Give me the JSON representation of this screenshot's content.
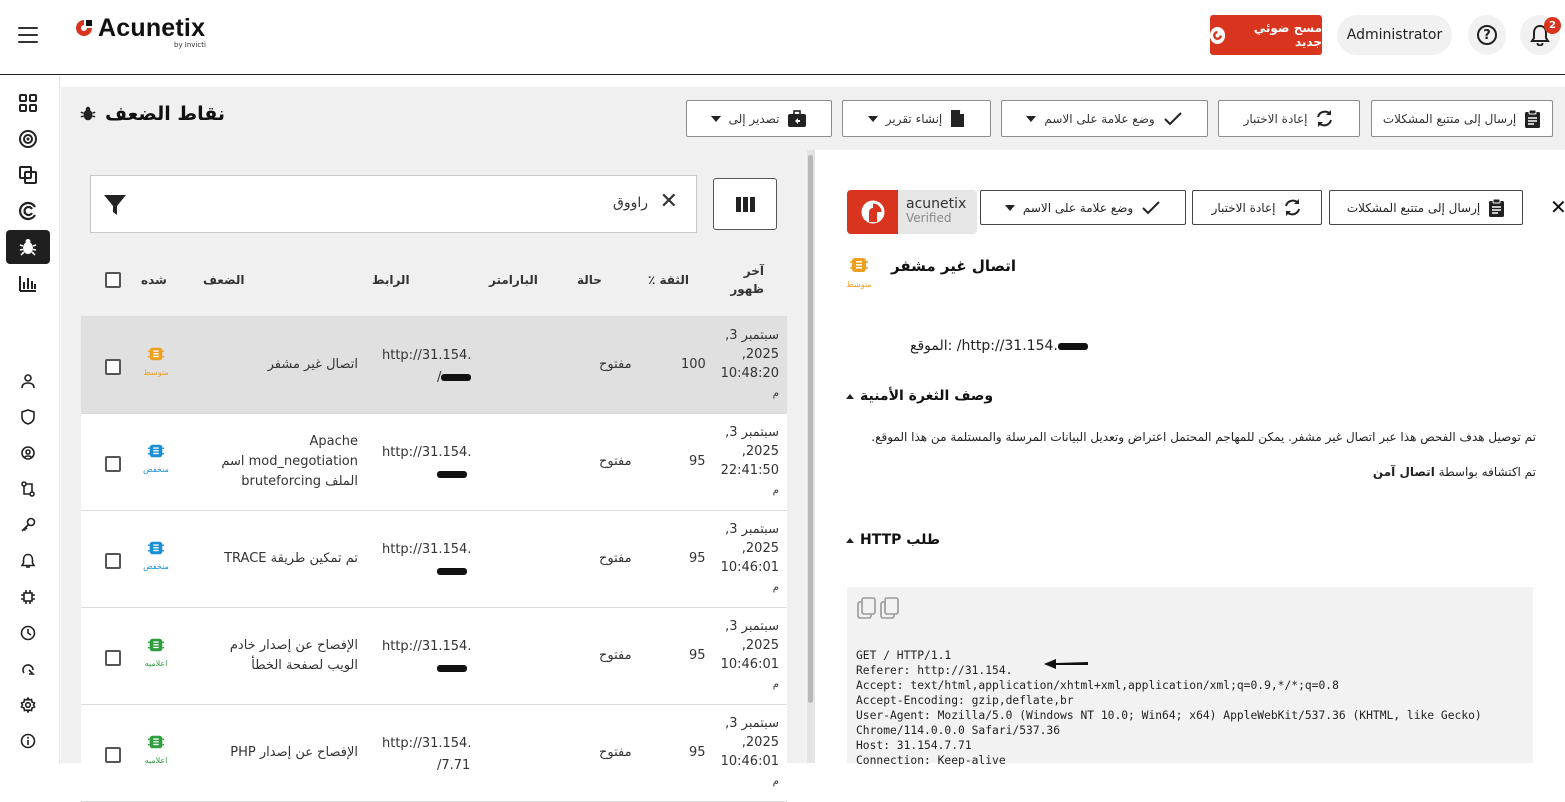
{
  "brand": {
    "name": "Acunetix",
    "sub": "by Invicti"
  },
  "topbar": {
    "new_scan_label": "مسح ضوئي جديد",
    "user_label": "Administrator",
    "help_glyph": "?",
    "notification_count": "2"
  },
  "sidebar": {
    "items": [
      {
        "icon": "dashboard-icon"
      },
      {
        "icon": "targets-icon"
      },
      {
        "icon": "scans-icon"
      },
      {
        "icon": "scan-profiles-icon"
      },
      {
        "icon": "vulnerabilities-bug-icon",
        "active": true
      },
      {
        "icon": "reports-icon"
      },
      {
        "icon": "users-icon"
      },
      {
        "icon": "shield-icon"
      },
      {
        "icon": "roles-icon"
      },
      {
        "icon": "integrations-icon"
      },
      {
        "icon": "key-icon"
      },
      {
        "icon": "notifications-icon"
      },
      {
        "icon": "agents-icon"
      },
      {
        "icon": "history-icon"
      },
      {
        "icon": "export-icon"
      },
      {
        "icon": "settings-icon"
      },
      {
        "icon": "info-icon"
      }
    ]
  },
  "page": {
    "title": "نقاط الضعف",
    "export_label": "تصدير إلى",
    "report_label": "إنشاء تقرير",
    "mark_label": "وضع علامة على الاسم",
    "retest_label": "إعادة الاختبار",
    "tracker_label": "إرسال إلى متتبع المشكلات"
  },
  "list": {
    "search_value": "راووق",
    "columns": {
      "severity": "شده",
      "vulnerability": "الضعف",
      "url": "الرابط",
      "parameter": "البارامتر",
      "status": "حالة",
      "confidence": "الثقة ٪",
      "last_seen": "آخر ظهور"
    },
    "rows": [
      {
        "severity": "متوسط",
        "vuln": "اتصال غير مشفر",
        "url": "http://31.154.",
        "url2": "/",
        "status": "مفتوح",
        "conf": "100",
        "date": "سبتمبر 3,",
        "year": "2025,",
        "time": "10:48:20",
        "ampm": "م"
      },
      {
        "severity": "منخفض",
        "vuln": "Apache mod_negotiation اسم الملف bruteforcing",
        "url": "http://31.154.",
        "url2": "",
        "status": "مفتوح",
        "conf": "95",
        "date": "سبتمبر 3,",
        "year": "2025,",
        "time": "22:41:50",
        "ampm": "م"
      },
      {
        "severity": "منخفض",
        "vuln": "تم تمكين طريقة TRACE",
        "url": "http://31.154.",
        "url2": "",
        "status": "مفتوح",
        "conf": "95",
        "date": "سبتمبر 3,",
        "year": "2025,",
        "time": "10:46:01",
        "ampm": "م"
      },
      {
        "severity": "اعلاميه",
        "vuln": "الإفصاح عن إصدار خادم الويب لصفحة الخطأ",
        "url": "http://31.154.",
        "url2": "",
        "status": "مفتوح",
        "conf": "95",
        "date": "سبتمبر 3,",
        "year": "2025,",
        "time": "10:46:01",
        "ampm": "م"
      },
      {
        "severity": "اعلاميه",
        "vuln": "الإفصاح عن إصدار PHP",
        "url": "http://31.154.",
        "url2": "/7.71",
        "status": "مفتوح",
        "conf": "95",
        "date": "سبتمبر 3,",
        "year": "2025,",
        "time": "10:46:01",
        "ampm": "م"
      }
    ]
  },
  "detail": {
    "verified_brand": "acunetix",
    "verified_label": "Verified",
    "mark_label": "وضع علامة على الاسم",
    "retest_label": "إعادة الاختبار",
    "tracker_label": "إرسال إلى متتبع المشكلات",
    "title": "اتصال غير مشفر",
    "severity": "متوسط",
    "location": "الموقع: /http://31.154.",
    "desc_heading": "وصف الثغرة الأمنية",
    "description": "تم توصيل هدف الفحص هذا عبر اتصال غير مشفر. يمكن للمهاجم المحتمل اعتراض وتعديل البيانات المرسلة والمستلمة من هذا الموقع.",
    "detected_prefix": "تم اكتشافه بواسطة",
    "detected_by": "اتصال آمن",
    "http_heading": "طلب HTTP",
    "request": "GET / HTTP/1.1\nReferer: http://31.154.\nAccept: text/html,application/xhtml+xml,application/xml;q=0.9,*/*;q=0.8\nAccept-Encoding: gzip,deflate,br\nUser-Agent: Mozilla/5.0 (Windows NT 10.0; Win64; x64) AppleWebKit/537.36 (KHTML, like Gecko)\nChrome/114.0.0.0 Safari/537.36\nHost: 31.154.7.71\nConnection: Keep-alive"
  },
  "colors": {
    "accent": "#d9341e",
    "medium": "#f0a020",
    "low": "#1a8fd6",
    "info": "#2e9e3e"
  }
}
